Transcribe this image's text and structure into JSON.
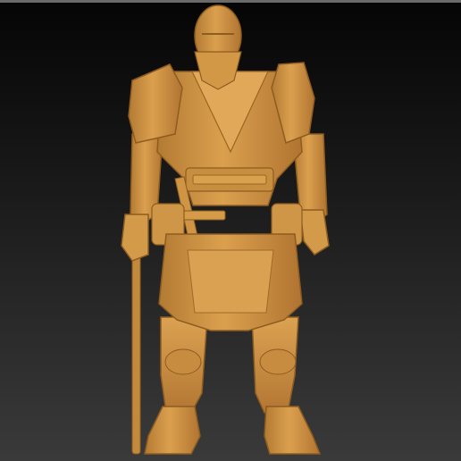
{
  "viewport": {
    "background_top": "#050505",
    "background_bottom": "#3a3a3a",
    "border_color": "#6a6a6a"
  },
  "model": {
    "subject": "armored-masked-warrior-sculpt",
    "material_color": "#d4933f",
    "shadow_color": "#9a6524",
    "highlight_color": "#e8ad5c"
  }
}
